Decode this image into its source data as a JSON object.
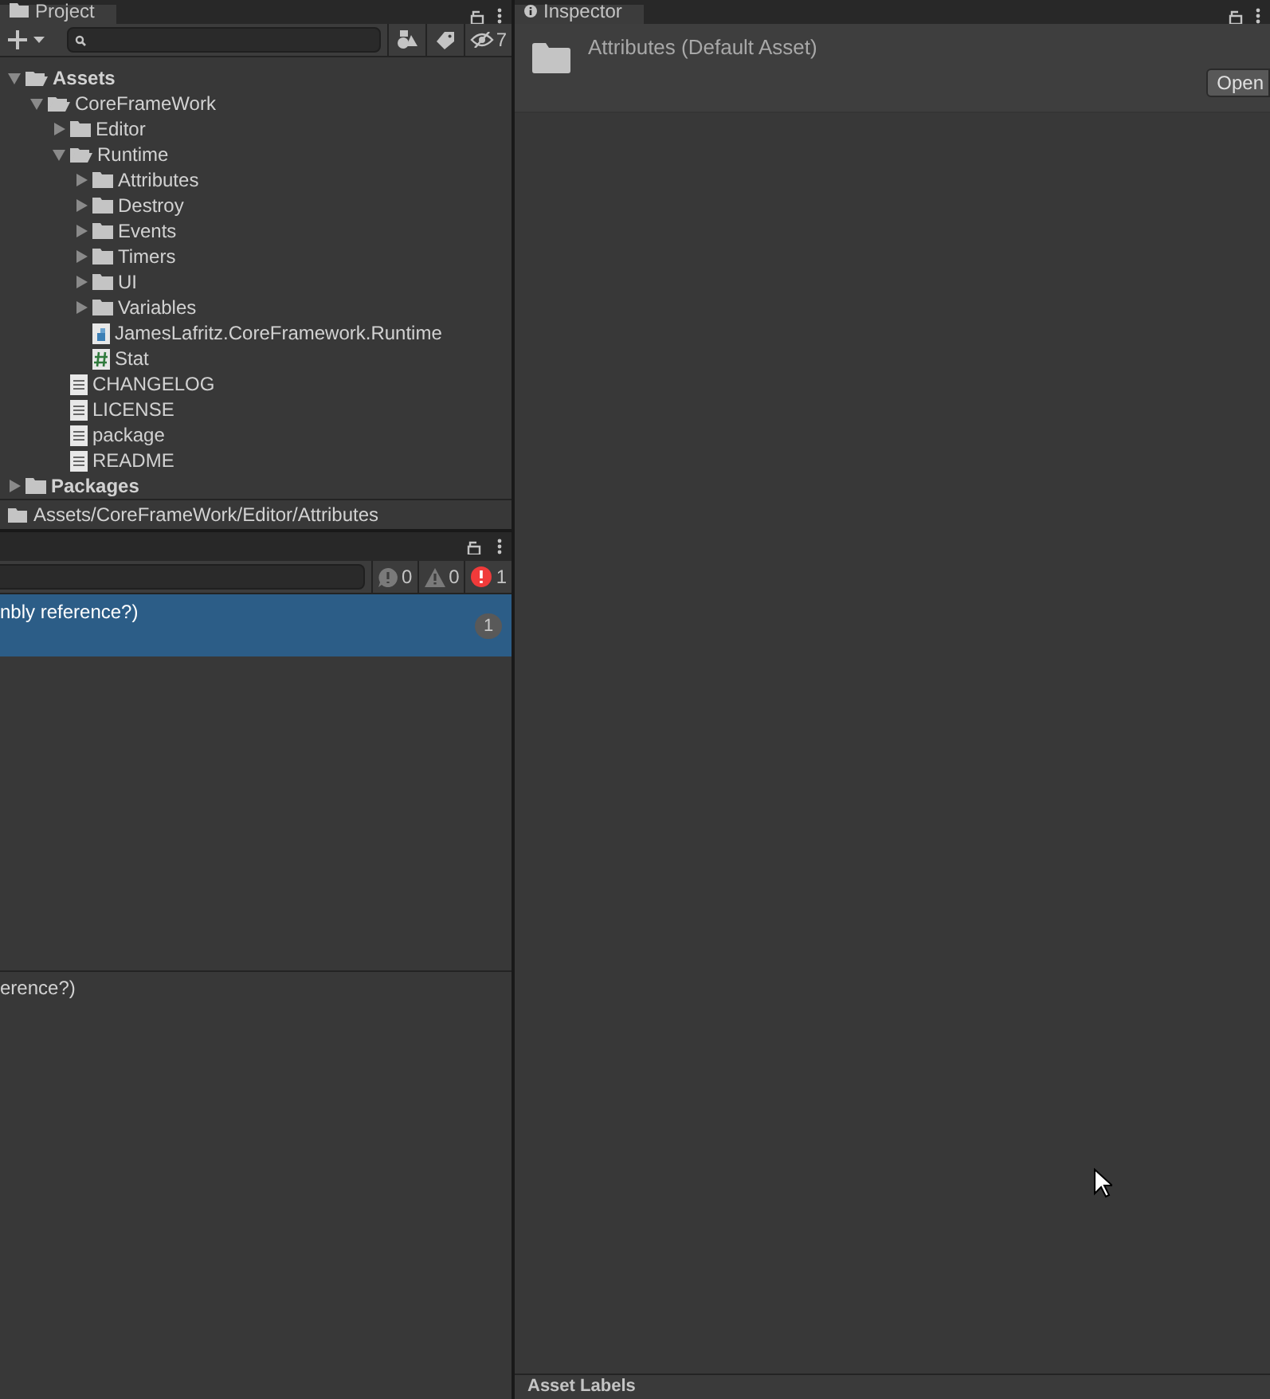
{
  "project_panel": {
    "tab": {
      "label": "Project",
      "selected": true
    },
    "visible_count": "7",
    "tree": [
      {
        "label": "Assets",
        "kind": "folder",
        "bold": true,
        "expanded": true,
        "children": [
          {
            "label": "CoreFrameWork",
            "kind": "folder",
            "expanded": true,
            "children": [
              {
                "label": "Editor",
                "kind": "folder",
                "expanded": false
              },
              {
                "label": "Runtime",
                "kind": "folder",
                "expanded": true,
                "children": [
                  {
                    "label": "Attributes",
                    "kind": "folder",
                    "expanded": false
                  },
                  {
                    "label": "Destroy",
                    "kind": "folder",
                    "expanded": false
                  },
                  {
                    "label": "Events",
                    "kind": "folder",
                    "expanded": false
                  },
                  {
                    "label": "Timers",
                    "kind": "folder",
                    "expanded": false
                  },
                  {
                    "label": "UI",
                    "kind": "folder",
                    "expanded": false
                  },
                  {
                    "label": "Variables",
                    "kind": "folder",
                    "expanded": false
                  },
                  {
                    "label": "JamesLafritz.CoreFramework.Runtime",
                    "kind": "assembly"
                  },
                  {
                    "label": "Stat",
                    "kind": "script"
                  }
                ]
              },
              {
                "label": "CHANGELOG",
                "kind": "text"
              },
              {
                "label": "LICENSE",
                "kind": "text"
              },
              {
                "label": "package",
                "kind": "text"
              },
              {
                "label": "README",
                "kind": "text"
              }
            ]
          }
        ]
      },
      {
        "label": "Packages",
        "kind": "folder",
        "bold": true,
        "expanded": false
      }
    ],
    "path": "Assets/CoreFrameWork/Editor/Attributes"
  },
  "console_panel": {
    "counts": [
      {
        "kind": "info",
        "value": "0"
      },
      {
        "kind": "warning",
        "value": "0"
      },
      {
        "kind": "error",
        "value": "1"
      }
    ],
    "entries": [
      {
        "text": "nbly reference?)",
        "count": "1",
        "selected": true
      }
    ],
    "detail": "erence?)"
  },
  "inspector_panel": {
    "tab": {
      "label": "Inspector",
      "selected": true
    },
    "title": "Attributes (Default Asset)",
    "open_button": "Open",
    "footer": "Asset Labels"
  }
}
